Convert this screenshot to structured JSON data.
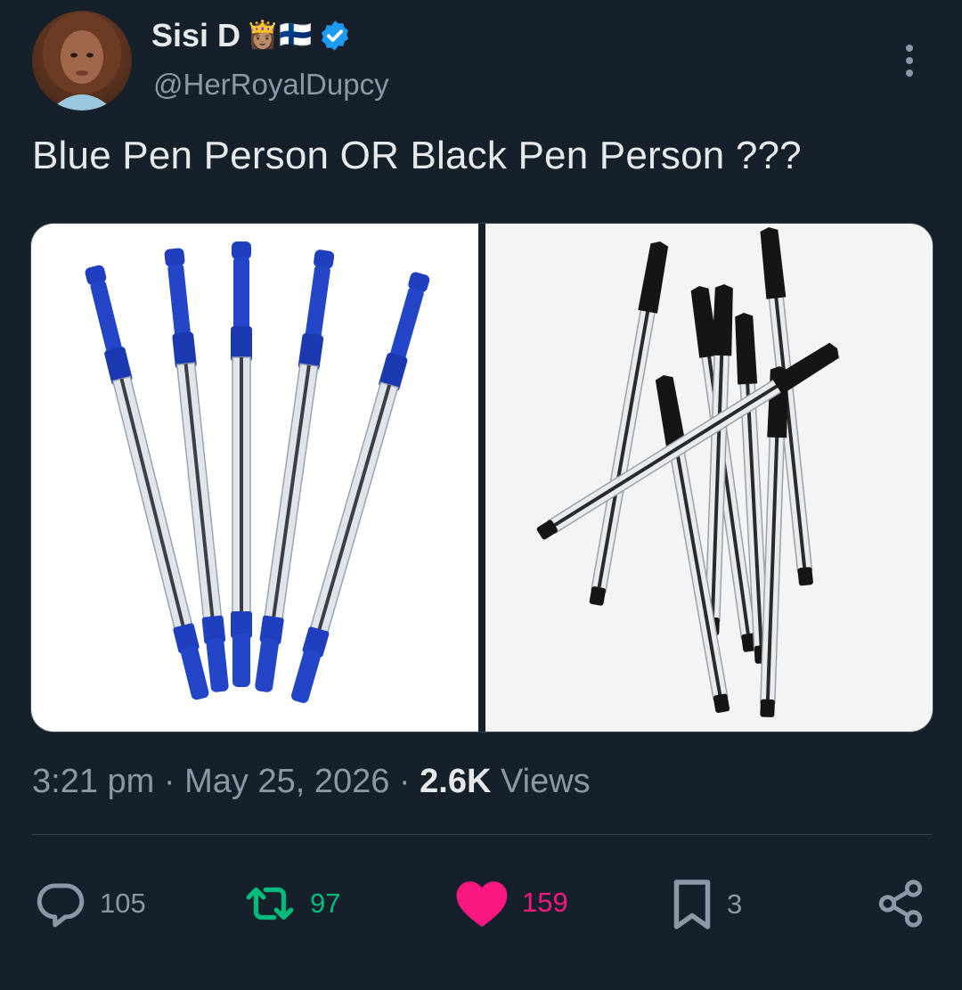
{
  "user": {
    "display_name": "Sisi D",
    "name_emojis": "👸🏽🇫🇮",
    "handle": "@HerRoyalDupcy",
    "verified": true
  },
  "tweet": {
    "text": "Blue Pen Person OR Black Pen Person ???",
    "time": "3:21 pm",
    "date": "May 25, 2026",
    "views_count": "2.6K",
    "views_label": "Views"
  },
  "media": [
    {
      "icon": "blue-pens-photo"
    },
    {
      "icon": "black-pens-photo"
    }
  ],
  "actions": {
    "replies": "105",
    "retweets": "97",
    "likes": "159",
    "bookmarks": "3"
  },
  "colors": {
    "background": "#15202b",
    "muted": "#8b98a5",
    "retweet": "#00ba7c",
    "like": "#f91880",
    "verified": "#1d9bf0"
  }
}
